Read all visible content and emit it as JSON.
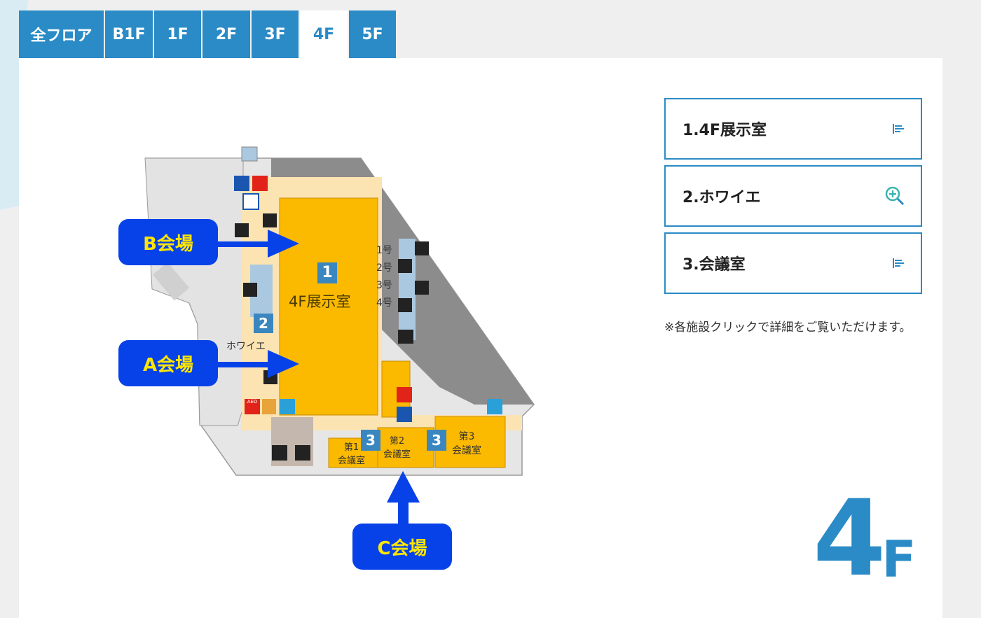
{
  "tabs": [
    {
      "label": "全フロア"
    },
    {
      "label": "B1F"
    },
    {
      "label": "1F"
    },
    {
      "label": "2F"
    },
    {
      "label": "3F"
    },
    {
      "label": "4F",
      "active": true
    },
    {
      "label": "5F"
    }
  ],
  "map": {
    "room_number_1": "1",
    "room_number_2": "2",
    "room_number_3a": "3",
    "room_number_3b": "3",
    "exhibition_room": "4F展示室",
    "foyer": "ホワイエ",
    "elevator_1": "1号",
    "elevator_2": "2号",
    "elevator_3": "3号",
    "elevator_4": "4号",
    "conf1_line1": "第1",
    "conf1_line2": "会議室",
    "conf2_line1": "第2",
    "conf2_line2": "会議室",
    "conf3_line1": "第3",
    "conf3_line2": "会議室",
    "aed": "AED"
  },
  "callouts": {
    "b": "B会場",
    "a": "A会場",
    "c": "C会場"
  },
  "facilities": [
    {
      "label": "1.4F展示室",
      "icon": "list-icon"
    },
    {
      "label": "2.ホワイエ",
      "icon": "zoom-in-icon"
    },
    {
      "label": "3.会議室",
      "icon": "list-icon"
    }
  ],
  "note": "※各施設クリックで詳細をご覧いただけます。",
  "floor_indicator": {
    "number": "4",
    "unit": "F"
  },
  "colors": {
    "accent": "#2a8bc6",
    "exhibition": "#fbb900",
    "callout_bg": "#0742e8",
    "callout_text": "#ffe600"
  }
}
